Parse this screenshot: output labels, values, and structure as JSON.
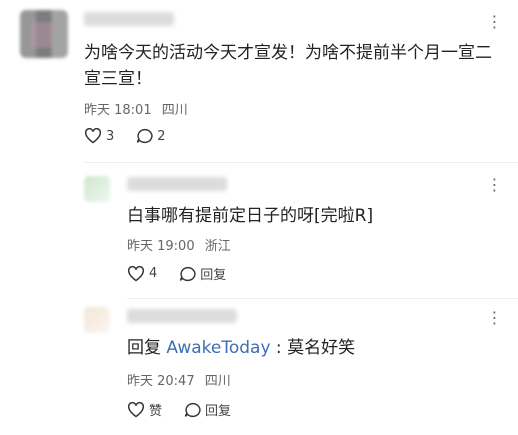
{
  "main_comment": {
    "text": "为啥今天的活动今天才宣发！为啥不提前半个月一宣二宣三宣！",
    "time": "昨天 18:01",
    "location": "四川",
    "likes": "3",
    "replies": "2"
  },
  "replies": [
    {
      "text": "白事哪有提前定日子的呀[完啦R]",
      "time": "昨天 19:00",
      "location": "浙江",
      "likes": "4",
      "reply_label": "回复"
    },
    {
      "prefix": "回复",
      "mention": "AwakeToday",
      "colon": " : ",
      "text": "莫名好笑",
      "time": "昨天 20:47",
      "location": "四川",
      "like_label": "赞",
      "reply_label": "回复"
    }
  ]
}
